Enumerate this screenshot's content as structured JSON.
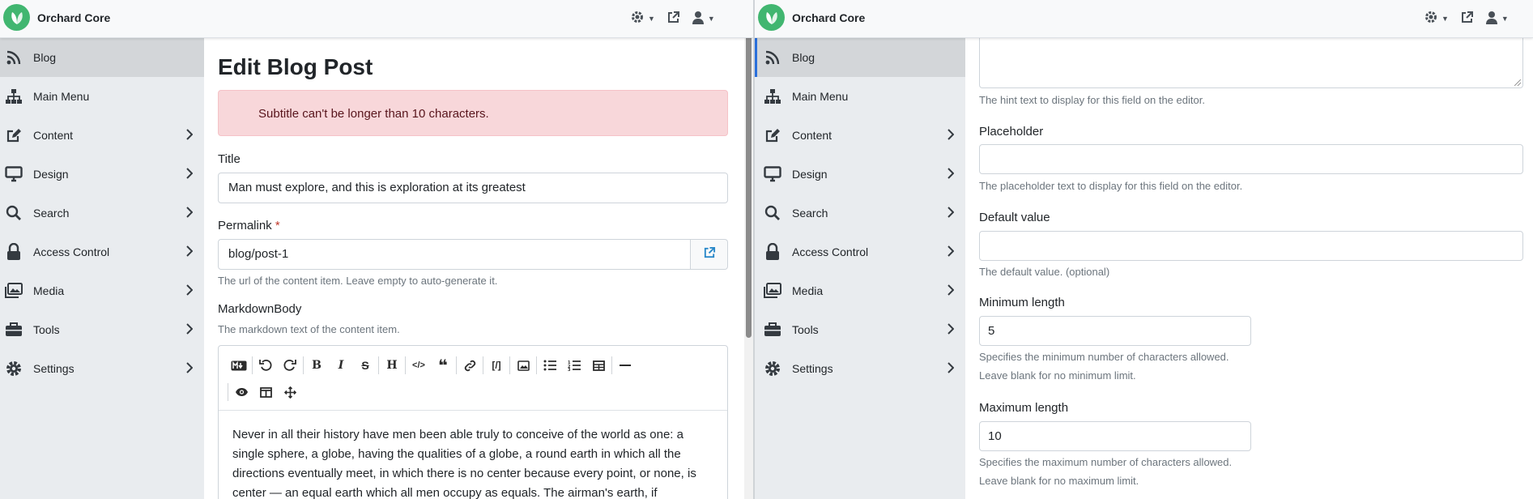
{
  "app": {
    "brand": "Orchard Core"
  },
  "sidebar": {
    "items": [
      {
        "label": "Blog",
        "icon": "rss-icon",
        "active": true
      },
      {
        "label": "Main Menu",
        "icon": "sitemap-icon"
      },
      {
        "label": "Content",
        "icon": "edit-icon"
      },
      {
        "label": "Design",
        "icon": "desktop-icon"
      },
      {
        "label": "Search",
        "icon": "search-icon"
      },
      {
        "label": "Access Control",
        "icon": "lock-icon"
      },
      {
        "label": "Media",
        "icon": "images-icon"
      },
      {
        "label": "Tools",
        "icon": "toolbox-icon"
      },
      {
        "label": "Settings",
        "icon": "gear-icon"
      }
    ]
  },
  "left": {
    "page_title": "Edit Blog Post",
    "alert": "Subtitle can't be longer than 10 characters.",
    "title": {
      "label": "Title",
      "value": "Man must explore, and this is exploration at its greatest"
    },
    "permalink": {
      "label": "Permalink",
      "required_mark": "*",
      "value": "blog/post-1",
      "hint": "The url of the content item. Leave empty to auto-generate it."
    },
    "markdown": {
      "label": "MarkdownBody",
      "hint": "The markdown text of the content item.",
      "body": "Never in all their history have men been able truly to conceive of the world as one: a single sphere, a globe, having the qualities of a globe, a round earth in which all the directions eventually meet, in which there is no center because every point, or none, is center — an equal earth which all men occupy as equals. The airman's earth, if"
    }
  },
  "right": {
    "hint_text_desc": "The hint text to display for this field on the editor.",
    "placeholder": {
      "label": "Placeholder",
      "value": "",
      "hint": "The placeholder text to display for this field on the editor."
    },
    "default_value": {
      "label": "Default value",
      "value": "",
      "hint": "The default value. (optional)"
    },
    "min_length": {
      "label": "Minimum length",
      "value": "5",
      "hint1": "Specifies the minimum number of characters allowed.",
      "hint2": "Leave blank for no minimum limit."
    },
    "max_length": {
      "label": "Maximum length",
      "value": "10",
      "hint1": "Specifies the maximum number of characters allowed.",
      "hint2": "Leave blank for no maximum limit."
    }
  }
}
